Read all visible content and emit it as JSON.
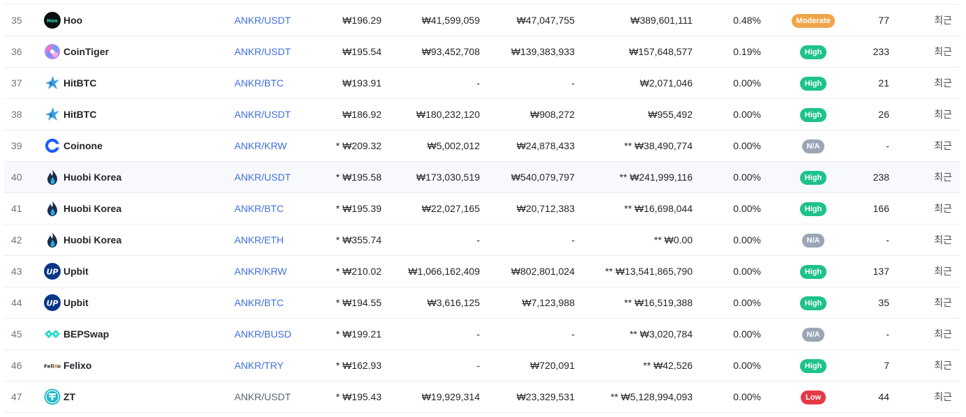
{
  "colors": {
    "high": "#1ec28b",
    "moderate": "#f0a54a",
    "na": "#9aa5b5",
    "low": "#e63946",
    "link": "#3e6fe0"
  },
  "rows": [
    {
      "rank": "35",
      "exchange": "Hoo",
      "icon": "hoo-logo-icon",
      "pair": "ANKR/USDT",
      "price": "₩196.29",
      "plus2": "₩41,599,059",
      "minus2": "₩47,047,755",
      "volume": "₩389,601,111",
      "volume_pct": "0.48%",
      "trust": "Moderate",
      "trust_key": "moderate",
      "score": "77",
      "updated": "최근"
    },
    {
      "rank": "36",
      "exchange": "CoinTiger",
      "icon": "cointiger-logo-icon",
      "pair": "ANKR/USDT",
      "price": "₩195.54",
      "plus2": "₩93,452,708",
      "minus2": "₩139,383,933",
      "volume": "₩157,648,577",
      "volume_pct": "0.19%",
      "trust": "High",
      "trust_key": "high",
      "score": "233",
      "updated": "최근"
    },
    {
      "rank": "37",
      "exchange": "HitBTC",
      "icon": "hitbtc-logo-icon",
      "pair": "ANKR/BTC",
      "price": "₩193.91",
      "plus2": "-",
      "minus2": "-",
      "volume": "₩2,071,046",
      "volume_pct": "0.00%",
      "trust": "High",
      "trust_key": "high",
      "score": "21",
      "updated": "최근"
    },
    {
      "rank": "38",
      "exchange": "HitBTC",
      "icon": "hitbtc-logo-icon",
      "pair": "ANKR/USDT",
      "price": "₩186.92",
      "plus2": "₩180,232,120",
      "minus2": "₩908,272",
      "volume": "₩955,492",
      "volume_pct": "0.00%",
      "trust": "High",
      "trust_key": "high",
      "score": "26",
      "updated": "최근"
    },
    {
      "rank": "39",
      "exchange": "Coinone",
      "icon": "coinone-logo-icon",
      "pair": "ANKR/KRW",
      "price": "* ₩209.32",
      "plus2": "₩5,002,012",
      "minus2": "₩24,878,433",
      "volume": "** ₩38,490,774",
      "volume_pct": "0.00%",
      "trust": "N/A",
      "trust_key": "na",
      "score": "-",
      "updated": "최근"
    },
    {
      "rank": "40",
      "exchange": "Huobi Korea",
      "icon": "huobi-logo-icon",
      "pair": "ANKR/USDT",
      "price": "* ₩195.58",
      "plus2": "₩173,030,519",
      "minus2": "₩540,079,797",
      "volume": "** ₩241,999,116",
      "volume_pct": "0.00%",
      "trust": "High",
      "trust_key": "high",
      "score": "238",
      "updated": "최근"
    },
    {
      "rank": "41",
      "exchange": "Huobi Korea",
      "icon": "huobi-logo-icon",
      "pair": "ANKR/BTC",
      "price": "* ₩195.39",
      "plus2": "₩22,027,165",
      "minus2": "₩20,712,383",
      "volume": "** ₩16,698,044",
      "volume_pct": "0.00%",
      "trust": "High",
      "trust_key": "high",
      "score": "166",
      "updated": "최근"
    },
    {
      "rank": "42",
      "exchange": "Huobi Korea",
      "icon": "huobi-logo-icon",
      "pair": "ANKR/ETH",
      "price": "* ₩355.74",
      "plus2": "-",
      "minus2": "-",
      "volume": "** ₩0.00",
      "volume_pct": "0.00%",
      "trust": "N/A",
      "trust_key": "na",
      "score": "-",
      "updated": "최근"
    },
    {
      "rank": "43",
      "exchange": "Upbit",
      "icon": "upbit-logo-icon",
      "pair": "ANKR/KRW",
      "price": "* ₩210.02",
      "plus2": "₩1,066,162,409",
      "minus2": "₩802,801,024",
      "volume": "** ₩13,541,865,790",
      "volume_pct": "0.00%",
      "trust": "High",
      "trust_key": "high",
      "score": "137",
      "updated": "최근"
    },
    {
      "rank": "44",
      "exchange": "Upbit",
      "icon": "upbit-logo-icon",
      "pair": "ANKR/BTC",
      "price": "* ₩194.55",
      "plus2": "₩3,616,125",
      "minus2": "₩7,123,988",
      "volume": "** ₩16,519,388",
      "volume_pct": "0.00%",
      "trust": "High",
      "trust_key": "high",
      "score": "35",
      "updated": "최근"
    },
    {
      "rank": "45",
      "exchange": "BEPSwap",
      "icon": "bepswap-logo-icon",
      "pair": "ANKR/BUSD",
      "price": "* ₩199.21",
      "plus2": "-",
      "minus2": "-",
      "volume": "** ₩3,020,784",
      "volume_pct": "0.00%",
      "trust": "N/A",
      "trust_key": "na",
      "score": "-",
      "updated": "최근"
    },
    {
      "rank": "46",
      "exchange": "Felixo",
      "icon": "felixo-logo-icon",
      "pair": "ANKR/TRY",
      "price": "* ₩162.93",
      "plus2": "-",
      "minus2": "₩720,091",
      "volume": "** ₩42,526",
      "volume_pct": "0.00%",
      "trust": "High",
      "trust_key": "high",
      "score": "7",
      "updated": "최근"
    },
    {
      "rank": "47",
      "exchange": "ZT",
      "icon": "zt-logo-icon",
      "pair": "ANKR/USDT",
      "price": "* ₩195.43",
      "plus2": "₩19,929,314",
      "minus2": "₩23,329,531",
      "volume": "** ₩5,128,994,093",
      "volume_pct": "0.00%",
      "trust": "Low",
      "trust_key": "low",
      "score": "44",
      "updated": "최근"
    }
  ]
}
